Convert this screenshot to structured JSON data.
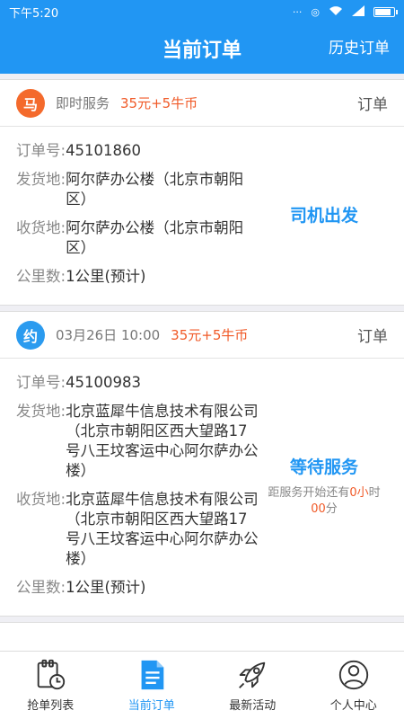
{
  "statusbar": {
    "time": "下午5:20"
  },
  "header": {
    "title": "当前订单",
    "history": "历史订单"
  },
  "orders": [
    {
      "badge": "马",
      "service": "即时服务",
      "price": "35元+5牛币",
      "link": "订单",
      "order_label": "订单号:",
      "order_no": "45101860",
      "from_label": "发货地:",
      "from": "阿尔萨办公楼（北京市朝阳区）",
      "to_label": "收货地:",
      "to": " 阿尔萨办公楼（北京市朝阳区）",
      "dist_label": "公里数:",
      "dist": "1公里(预计)",
      "status": "司机出发"
    },
    {
      "badge": "约",
      "service": "03月26日 10:00",
      "price": "35元+5牛币",
      "link": "订单",
      "order_label": "订单号:",
      "order_no": "45100983",
      "from_label": "发货地:",
      "from": "北京蓝犀牛信息技术有限公司（北京市朝阳区西大望路17号八王坟客运中心阿尔萨办公楼）",
      "to_label": "收货地:",
      "to": " 北京蓝犀牛信息技术有限公司（北京市朝阳区西大望路17号八王坟客运中心阿尔萨办公楼）",
      "dist_label": "公里数:",
      "dist": "1公里(预计)",
      "status": "等待服务",
      "countdown_prefix": "距服务开始还有",
      "countdown_hi1": "0小",
      "countdown_mid": "时",
      "countdown_hi2": "00",
      "countdown_suffix": "分"
    }
  ],
  "tabs": [
    {
      "label": "抢单列表",
      "icon": "clipboard-clock-icon"
    },
    {
      "label": "当前订单",
      "icon": "document-icon"
    },
    {
      "label": "最新活动",
      "icon": "rocket-icon"
    },
    {
      "label": "个人中心",
      "icon": "person-icon"
    }
  ],
  "colors": {
    "primary": "#2196f3",
    "price": "#f05a28",
    "badge_orange": "#f46a2c",
    "badge_blue": "#2b9bef"
  }
}
